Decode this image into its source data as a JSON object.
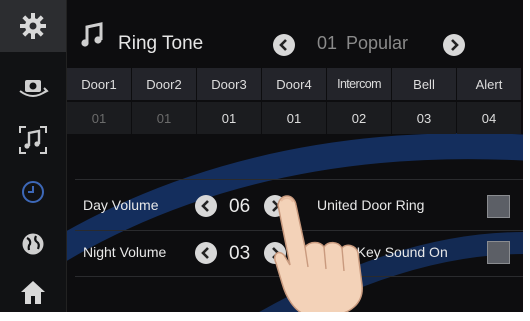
{
  "header": {
    "title": "Ring Tone",
    "preset_number": "01",
    "preset_name": "Popular"
  },
  "sidebar": {
    "items": [
      {
        "icon": "gear-icon",
        "active": true
      },
      {
        "icon": "camera-rotate-icon",
        "active": false
      },
      {
        "icon": "music-note-icon",
        "active": false
      },
      {
        "icon": "clock-icon",
        "active": false
      },
      {
        "icon": "globe-icon",
        "active": false
      },
      {
        "icon": "home-icon",
        "active": false
      }
    ]
  },
  "ringtone_table": {
    "columns": [
      "Door1",
      "Door2",
      "Door3",
      "Door4",
      "Intercom",
      "Bell",
      "Alert"
    ],
    "values": [
      "01",
      "01",
      "01",
      "01",
      "02",
      "03",
      "04"
    ]
  },
  "volume": {
    "day_label": "Day Volume",
    "day_value": "06",
    "night_label": "Night Volume",
    "night_value": "03",
    "united_door_ring_label": "United Door Ring",
    "key_sound_label": "h Key Sound On"
  },
  "colors": {
    "background": "#0d0d0f",
    "accent_blue": "#1f4e9a",
    "button": "#d8d8d8"
  }
}
